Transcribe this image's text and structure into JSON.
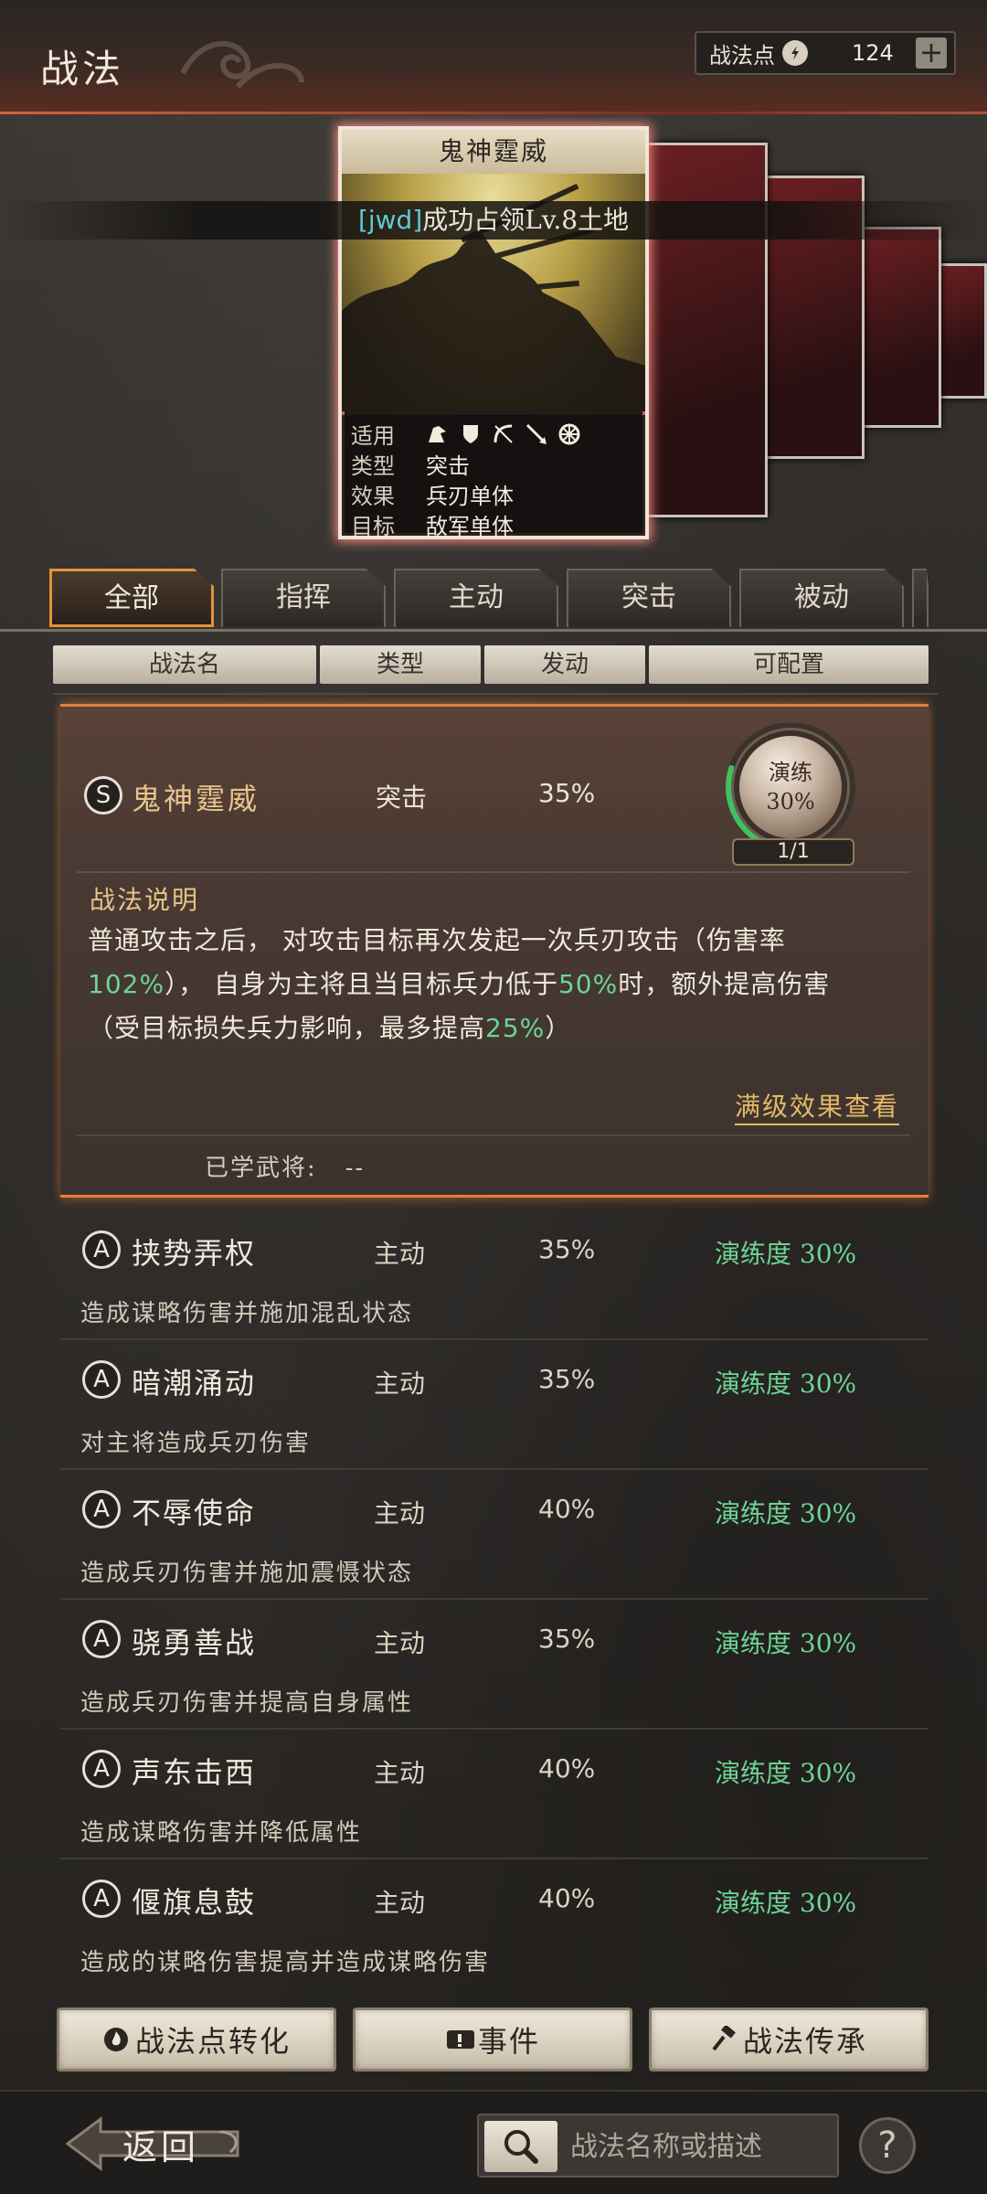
{
  "header": {
    "title": "战法",
    "points_label": "战法点",
    "points_value": "124",
    "plus_label": "+"
  },
  "card": {
    "title": "鬼神霆威",
    "rows": [
      {
        "key": "适用",
        "value": ""
      },
      {
        "key": "类型",
        "value": "突击"
      },
      {
        "key": "效果",
        "value": "兵刃单体"
      },
      {
        "key": "目标",
        "value": "敌军单体"
      }
    ],
    "adapt_icons": [
      "cavalry-icon",
      "shield-icon",
      "bow-icon",
      "spear-icon",
      "wheel-icon"
    ]
  },
  "banner": {
    "tag": "[jwd]",
    "text": "成功占领Lv.8土地"
  },
  "tabs": [
    "全部",
    "指挥",
    "主动",
    "突击",
    "被动"
  ],
  "columns": [
    "战法名",
    "类型",
    "发动",
    "可配置"
  ],
  "expanded": {
    "grade": "S",
    "name": "鬼神霆威",
    "type": "突击",
    "rate": "35%",
    "orb_label": "演练",
    "orb_value": "30%",
    "orb_progress": 0.3,
    "count": "1/1",
    "desc_title": "战法说明",
    "desc_1": "普通攻击之后，  对攻击目标再次发起一次兵刃攻击（伤害率",
    "desc_2a": "102%",
    "desc_2b": "），  自身为主将且当目标兵力低于",
    "desc_2c": "50%",
    "desc_2d": "时，额外提高伤害",
    "desc_3a": "（受目标损失兵力影响，最多提高",
    "desc_3b": "25%",
    "desc_3c": "）",
    "max_link": "满级效果查看",
    "learned_label": "已学武将:",
    "learned_value": "--"
  },
  "items": [
    {
      "grade": "A",
      "name": "挟势弄权",
      "type": "主动",
      "rate": "35%",
      "proficiency": "演练度 30%",
      "desc": "造成谋略伤害并施加混乱状态"
    },
    {
      "grade": "A",
      "name": "暗潮涌动",
      "type": "主动",
      "rate": "35%",
      "proficiency": "演练度 30%",
      "desc": "对主将造成兵刃伤害"
    },
    {
      "grade": "A",
      "name": "不辱使命",
      "type": "主动",
      "rate": "40%",
      "proficiency": "演练度 30%",
      "desc": "造成兵刃伤害并施加震慑状态"
    },
    {
      "grade": "A",
      "name": "骁勇善战",
      "type": "主动",
      "rate": "35%",
      "proficiency": "演练度 30%",
      "desc": "造成兵刃伤害并提高自身属性"
    },
    {
      "grade": "A",
      "name": "声东击西",
      "type": "主动",
      "rate": "40%",
      "proficiency": "演练度 30%",
      "desc": "造成谋略伤害并降低属性"
    },
    {
      "grade": "A",
      "name": "偃旗息鼓",
      "type": "主动",
      "rate": "40%",
      "proficiency": "演练度 30%",
      "desc": "造成的谋略伤害提高并造成谋略伤害"
    }
  ],
  "buttons": {
    "convert": "战法点转化",
    "event": "事件",
    "inherit": "战法传承"
  },
  "footer": {
    "back": "返回",
    "search_placeholder": "战法名称或描述",
    "help": "?"
  }
}
